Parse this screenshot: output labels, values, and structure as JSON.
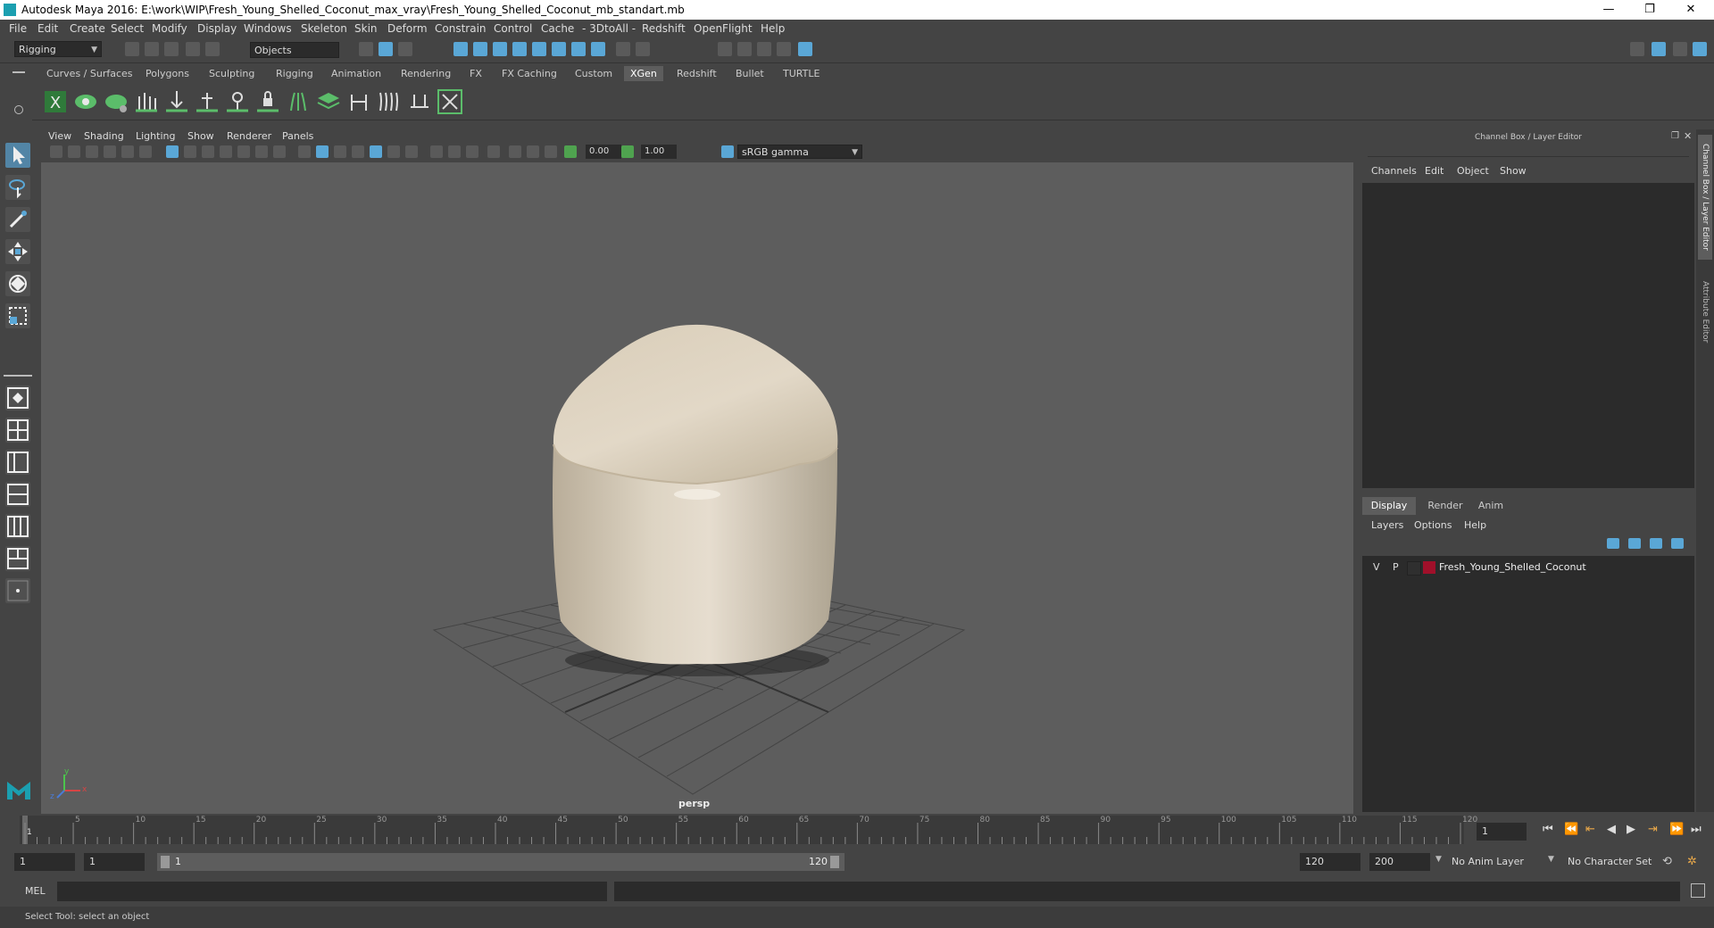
{
  "window": {
    "title": "Autodesk Maya 2016: E:\\work\\WIP\\Fresh_Young_Shelled_Coconut_max_vray\\Fresh_Young_Shelled_Coconut_mb_standart.mb",
    "minimize": "—",
    "restore": "❐",
    "close": "✕"
  },
  "menubar": [
    "File",
    "Edit",
    "Create",
    "Select",
    "Modify",
    "Display",
    "Windows",
    "Skeleton",
    "Skin",
    "Deform",
    "Constrain",
    "Control",
    "Cache",
    "- 3DtoAll -",
    "Redshift",
    "OpenFlight",
    "Help"
  ],
  "statusline": {
    "mode": "Rigging",
    "selection_mask": "Objects"
  },
  "shelf_tabs": [
    "Curves / Surfaces",
    "Polygons",
    "Sculpting",
    "Rigging",
    "Animation",
    "Rendering",
    "FX",
    "FX Caching",
    "Custom",
    "XGen",
    "Redshift",
    "Bullet",
    "TURTLE"
  ],
  "shelf_active_tab": "XGen",
  "panel_menu": [
    "View",
    "Shading",
    "Lighting",
    "Show",
    "Renderer",
    "Panels"
  ],
  "panel_toolbar": {
    "exposure": "0.00",
    "gamma": "1.00",
    "color_space": "sRGB gamma"
  },
  "viewport": {
    "camera_label": "persp",
    "axis": {
      "x": "x",
      "y": "y",
      "z": "z"
    }
  },
  "channel_box": {
    "title": "Channel Box / Layer Editor",
    "menu": [
      "Channels",
      "Edit",
      "Object",
      "Show"
    ]
  },
  "layer_editor": {
    "tabs": [
      "Display",
      "Render",
      "Anim"
    ],
    "active_tab": "Display",
    "menu": [
      "Layers",
      "Options",
      "Help"
    ],
    "layers": [
      {
        "visible": "V",
        "playback": "P",
        "name": "Fresh_Young_Shelled_Coconut",
        "color": "#a0102a"
      }
    ]
  },
  "side_tabs": [
    "Channel Box / Layer Editor",
    "Attribute Editor"
  ],
  "timeline": {
    "ticks": [
      1,
      5,
      10,
      15,
      20,
      25,
      30,
      35,
      40,
      45,
      50,
      55,
      60,
      65,
      70,
      75,
      80,
      85,
      90,
      95,
      100,
      105,
      110,
      115,
      120
    ],
    "current_frame": "1",
    "start": 1,
    "end": 120
  },
  "range": {
    "start_time": "1",
    "playback_start": "1",
    "slider_start": "1",
    "slider_end": "120",
    "playback_end": "120",
    "end_time": "200",
    "anim_layer": "No Anim Layer",
    "character_set": "No Character Set"
  },
  "command_line": {
    "label": "MEL"
  },
  "help_line": "Select Tool: select an object",
  "colors": {
    "accent": "#5285a6",
    "viewport_bg": "#5d5d5d",
    "panel_bg": "#444444",
    "field_bg": "#2b2b2b"
  }
}
